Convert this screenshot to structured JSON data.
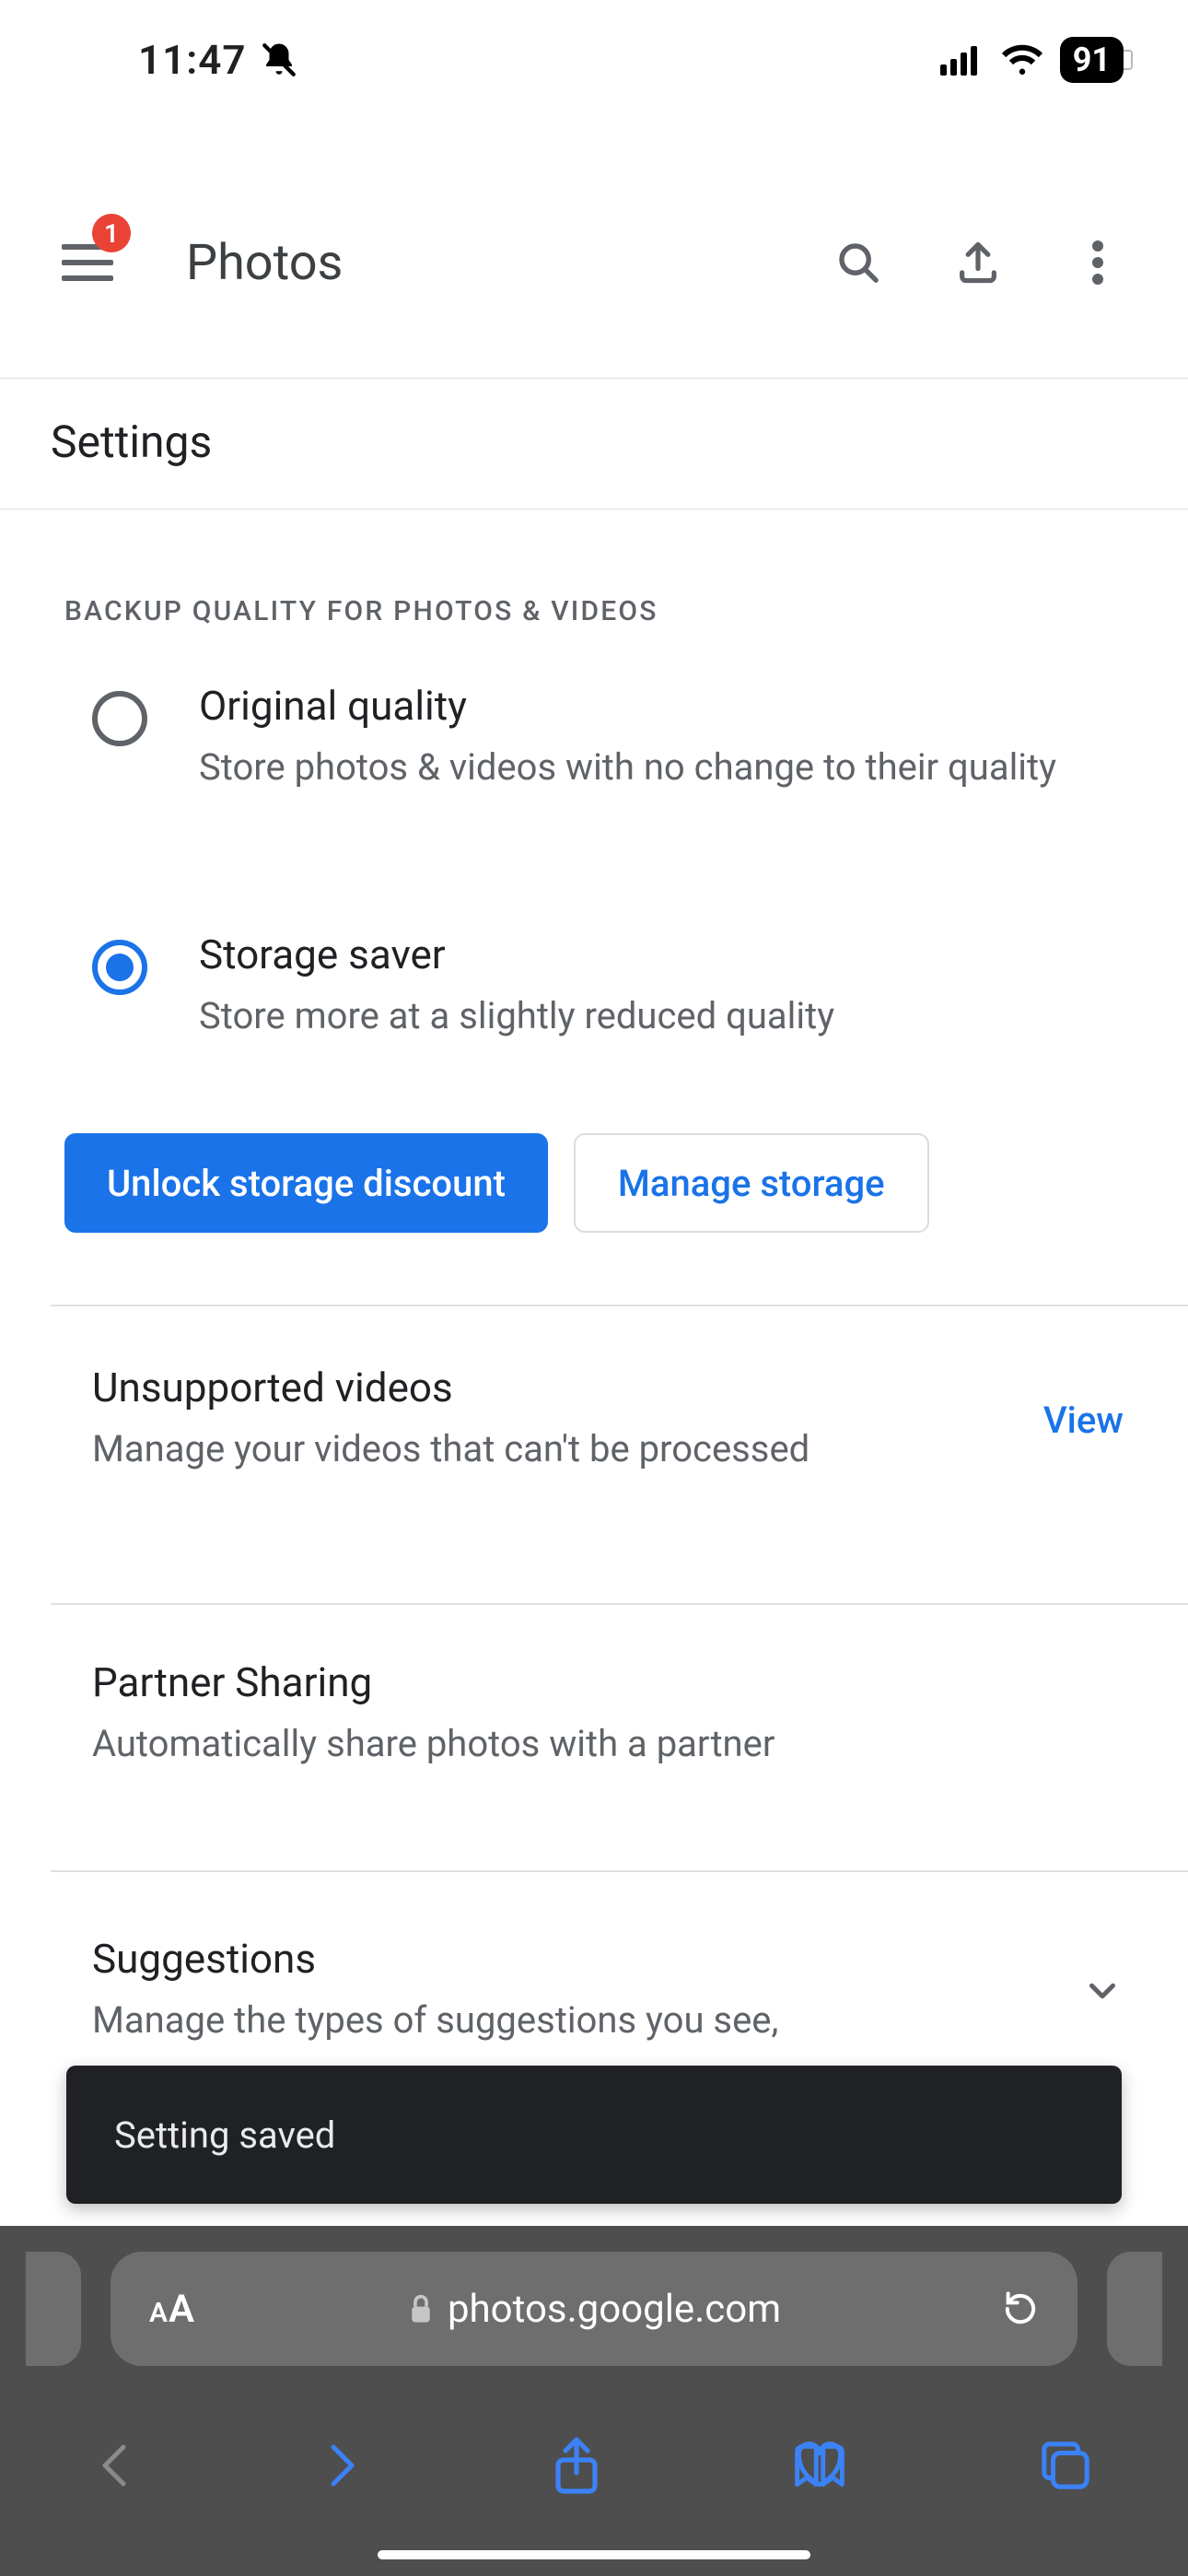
{
  "status_bar": {
    "time": "11:47",
    "battery": "91"
  },
  "header": {
    "title": "Photos",
    "menu_badge": "1"
  },
  "subheader": "Settings",
  "section_header": "BACKUP QUALITY FOR PHOTOS & VIDEOS",
  "quality": {
    "original": {
      "title": "Original quality",
      "sub": "Store photos & videos with no change to their quality"
    },
    "saver": {
      "title": "Storage saver",
      "sub": "Store more at a slightly reduced quality"
    }
  },
  "buttons": {
    "unlock": "Unlock storage discount",
    "manage": "Manage storage"
  },
  "rows": {
    "unsupported": {
      "title": "Unsupported videos",
      "sub": "Manage your videos that can't be processed",
      "action": "View"
    },
    "partner": {
      "title": "Partner Sharing",
      "sub": "Automatically share photos with a partner"
    },
    "suggest": {
      "title": "Suggestions",
      "sub": "Manage the types of suggestions you see,"
    }
  },
  "toast": "Setting saved",
  "browser": {
    "url": "photos.google.com",
    "aa_small": "A",
    "aa_big": "A"
  }
}
